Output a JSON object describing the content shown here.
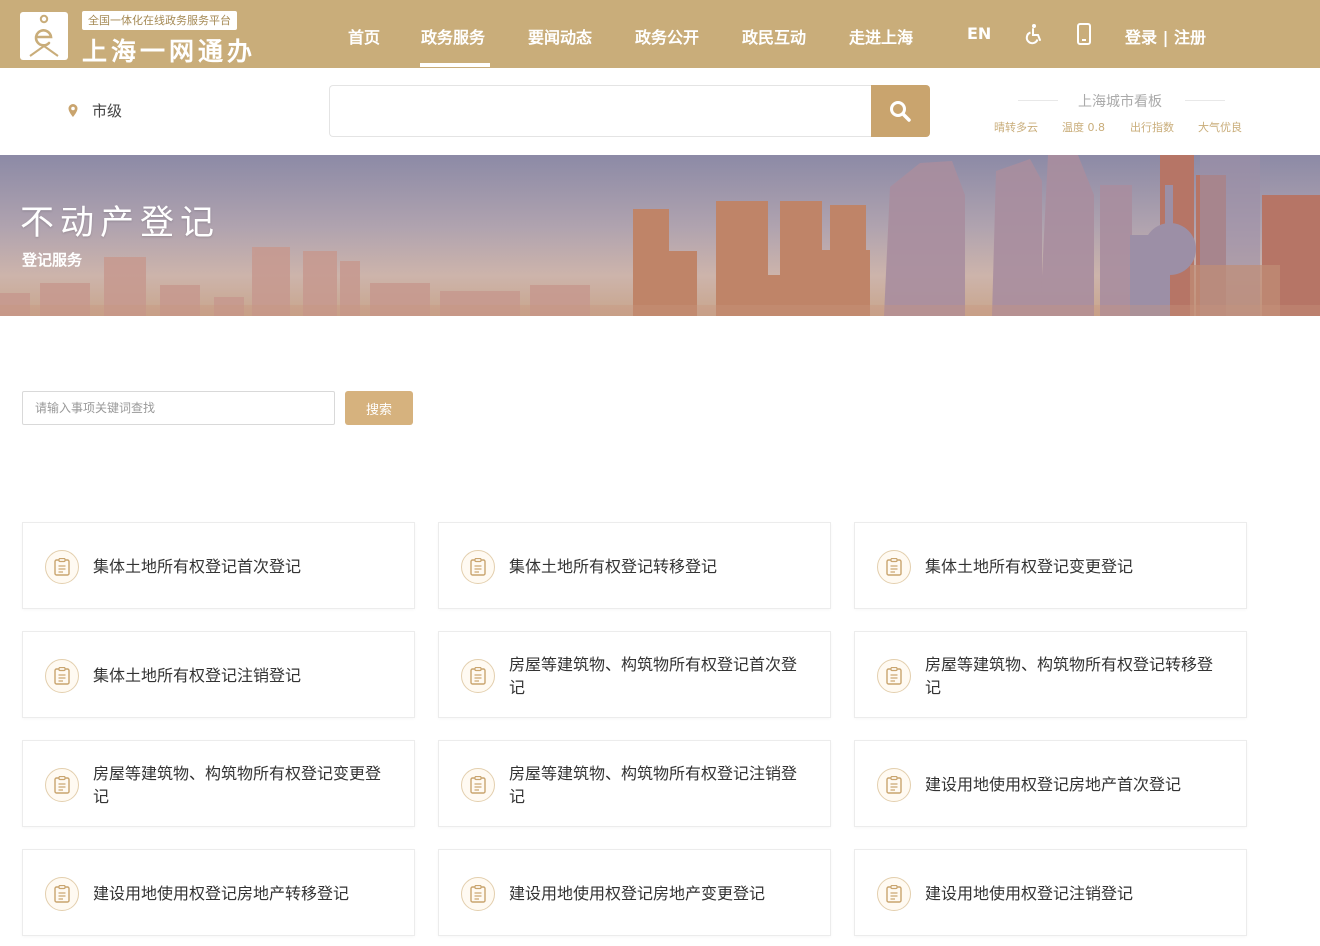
{
  "header": {
    "logo_subtitle": "全国一体化在线政务服务平台",
    "logo_title": "上海一网通办",
    "nav": [
      {
        "label": "首页"
      },
      {
        "label": "政务服务"
      },
      {
        "label": "要闻动态"
      },
      {
        "label": "政务公开"
      },
      {
        "label": "政民互动"
      },
      {
        "label": "走进上海"
      },
      {
        "label": "EN"
      }
    ],
    "login_label": "登录 | 注册",
    "icons": {
      "accessibility": "wheelchair-icon",
      "mobile": "mobile-phone-icon"
    }
  },
  "search": {
    "location": "市级",
    "main_value": ""
  },
  "weather": {
    "title": "上海城市看板",
    "items": [
      "晴转多云",
      "温度 0.8",
      "出行指数",
      "大气优良"
    ]
  },
  "banner": {
    "title": "不动产登记",
    "subtitle": "登记服务"
  },
  "item_search": {
    "placeholder": "请输入事项关键词查找",
    "button_label": "搜索"
  },
  "services": [
    {
      "label": "集体土地所有权登记首次登记"
    },
    {
      "label": "集体土地所有权登记转移登记"
    },
    {
      "label": "集体土地所有权登记变更登记"
    },
    {
      "label": "集体土地所有权登记注销登记"
    },
    {
      "label": "房屋等建筑物、构筑物所有权登记首次登记"
    },
    {
      "label": "房屋等建筑物、构筑物所有权登记转移登记"
    },
    {
      "label": "房屋等建筑物、构筑物所有权登记变更登记"
    },
    {
      "label": "房屋等建筑物、构筑物所有权登记注销登记"
    },
    {
      "label": "建设用地使用权登记房地产首次登记"
    },
    {
      "label": "建设用地使用权登记房地产转移登记"
    },
    {
      "label": "建设用地使用权登记房地产变更登记"
    },
    {
      "label": "建设用地使用权登记注销登记"
    }
  ],
  "colors": {
    "brand": "#c9ad7a",
    "button": "#c9a46e",
    "accent_icon": "#c9a46e"
  }
}
